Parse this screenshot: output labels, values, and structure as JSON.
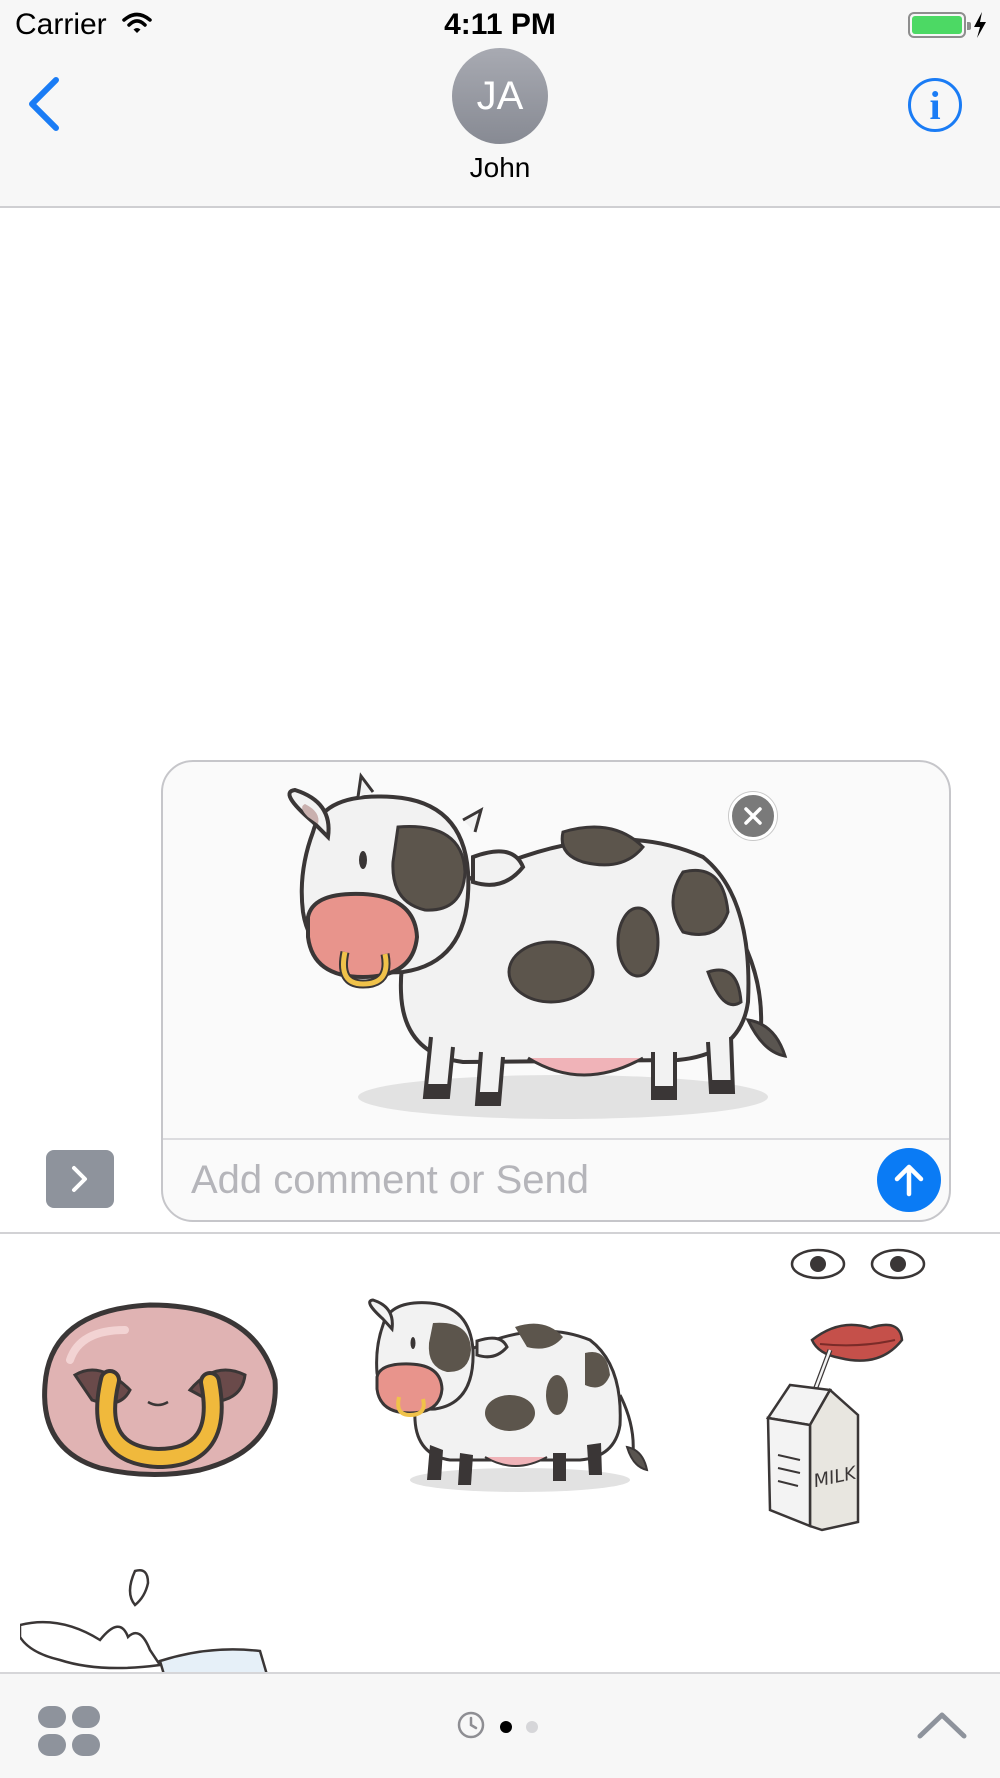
{
  "status_bar": {
    "carrier": "Carrier",
    "time": "4:11 PM"
  },
  "header": {
    "contact_initials": "JA",
    "contact_name": "John"
  },
  "icons": {
    "back": "chevron-left-icon",
    "info": "info-icon",
    "info_glyph": "i",
    "expand": "chevron-right-icon",
    "remove": "close-icon",
    "send": "arrow-up-icon",
    "apps": "app-drawer-icon",
    "recents": "clock-icon",
    "collapse": "chevron-up-icon"
  },
  "compose": {
    "placeholder": "Add comment or Send",
    "attached_sticker": "cow"
  },
  "sticker_drawer": {
    "stickers": [
      "nose-ring",
      "cow",
      "milk-carton",
      "milk-splash"
    ],
    "carton_text": "MILK"
  },
  "pager": {
    "pages": 2,
    "current_page": 1
  },
  "colors": {
    "accent_blue": "#1a7cf5",
    "send_blue": "#0a7bf5",
    "battery_green": "#4cd964",
    "avatar_gray": "#8e9099"
  }
}
